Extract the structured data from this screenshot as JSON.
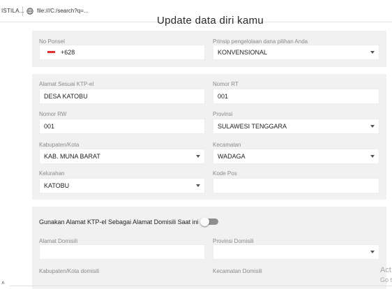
{
  "browser": {
    "tab_title": "ISTILA...",
    "url": "file:///C:/search?q=..."
  },
  "page": {
    "title": "Update data diri kamu"
  },
  "phone_section": {
    "phone_label": "No Ponsel",
    "phone_value": "+628",
    "phone_flag": "indonesia-flag",
    "principle_label": "Prinsip pengelolaan dana pilihan Anda",
    "principle_value": "KONVENSIONAL"
  },
  "ktp_address": {
    "address_label": "Alamat Sesuai KTP-el",
    "address_value": "DESA KATOBU",
    "rt_label": "Nomor RT",
    "rt_value": "001",
    "rw_label": "Nomor RW",
    "rw_value": "001",
    "province_label": "Provinsi",
    "province_value": "SULAWESI TENGGARA",
    "city_label": "Kabupaten/Kota",
    "city_value": "KAB. MUNA BARAT",
    "district_label": "Kecamatan",
    "district_value": "WADAGA",
    "village_label": "Kelurahan",
    "village_value": "KATOBU",
    "postal_label": "Kode Pos",
    "postal_value": ""
  },
  "domicile": {
    "toggle_label": "Gunakan Alamat KTP-el Sebagai Alamat Domisili Saat ini",
    "toggle_on": false,
    "address_label": "Alamat Domisili",
    "address_value": "",
    "province_label": "Provinsi Domisili",
    "province_value": "",
    "city_label": "Kabupaten/Kota domisili",
    "district_label": "Kecamatan Domisili"
  },
  "watermark": {
    "line1": "Act",
    "line2": "Go t"
  },
  "colors": {
    "card_bg": "#f1f1f1",
    "toggle_off": "#8e8e8e",
    "flag_red": "#e0302d"
  }
}
